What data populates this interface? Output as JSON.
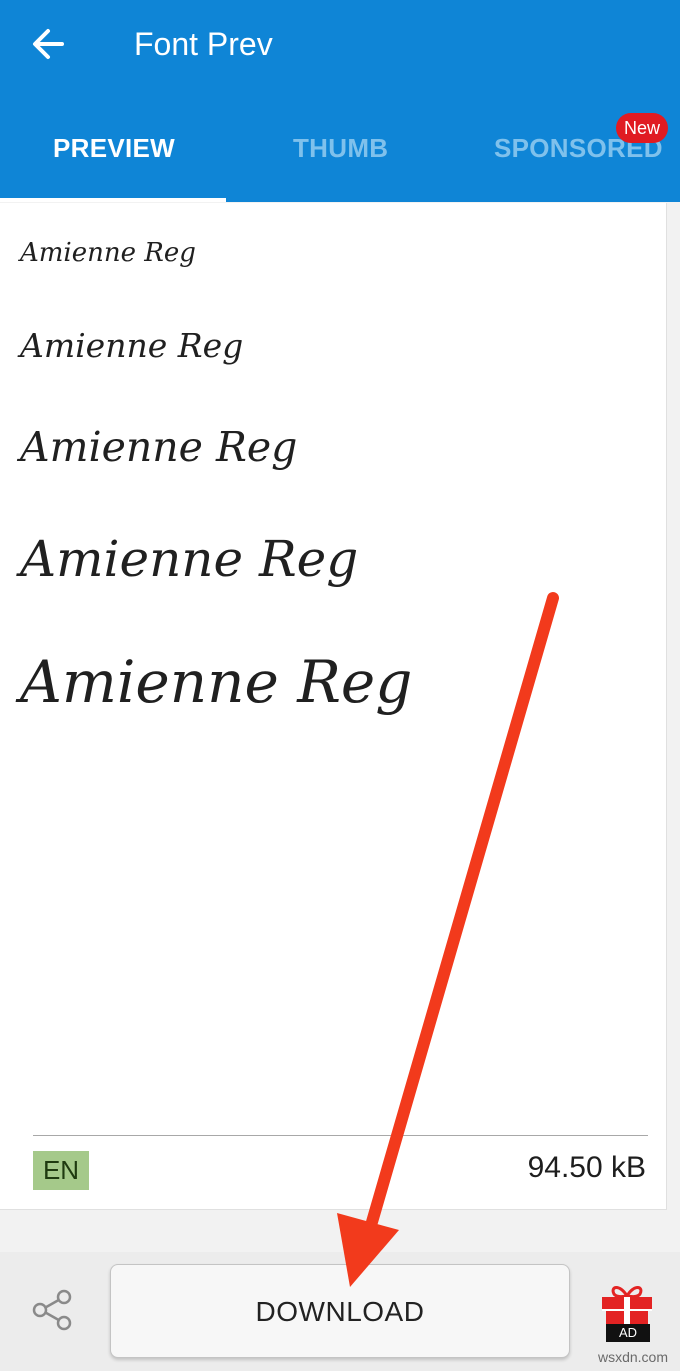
{
  "app_bar": {
    "title": "Font Prev",
    "back_icon": "arrow-left-icon",
    "background_color": "#0f85d6"
  },
  "tabs": [
    {
      "label": "PREVIEW",
      "active": true
    },
    {
      "label": "THUMB",
      "active": false
    },
    {
      "label": "SPONSORED",
      "active": false
    }
  ],
  "new_badge": "New",
  "preview": {
    "lines": [
      "Amienne Reg",
      "Amienne Reg",
      "Amienne Reg",
      "Amienne Reg",
      "Amienne Reg"
    ]
  },
  "footer": {
    "language": "EN",
    "file_size": "94.50 kB"
  },
  "bottom_bar": {
    "share_icon": "share-icon",
    "download_label": "DOWNLOAD",
    "gift_icon": "gift-icon",
    "ad_label": "AD"
  },
  "watermark": "wsxdn.com",
  "colors": {
    "accent": "#0f85d6",
    "badge_red": "#e01b22",
    "annotation_arrow": "#f23a1c",
    "language_badge": "#a5c98a"
  }
}
